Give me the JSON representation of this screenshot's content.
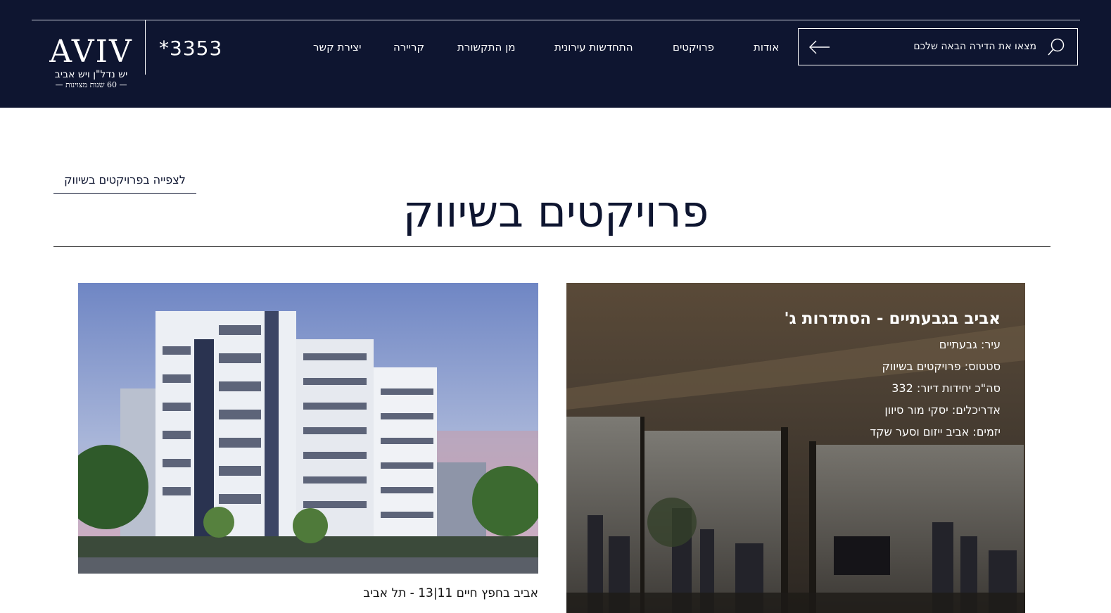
{
  "header": {
    "logo_word": "AVIV",
    "logo_sub": "יש נדל\"ן ויש אביב",
    "logo_tag": "— 60 שנות מצוינות —",
    "phone": "*3353",
    "nav": [
      "אודות",
      "פרויקטים",
      "התחדשות עירונית",
      "מן התקשורת",
      "קריירה",
      "יצירת קשר"
    ],
    "search_placeholder": "מצאו את הדירה הבאה שלכם"
  },
  "main": {
    "title": "פרויקטים בשיווק",
    "view_link": "לצפייה בפרויקטים בשיווק"
  },
  "cards": {
    "left": {
      "caption": "אביב בחפץ חיים 11|13 - תל אביב"
    },
    "right": {
      "title": "אביב בגבעתיים - הסתדרות ג'",
      "rows": [
        "עיר: גבעתיים",
        "סטטוס: פרויקטים בשיווק",
        "סה\"כ יחידות דיור: 332",
        "אדריכלים: יסקי מור סיוון",
        "יזמים: אביב ייזום וסער שקד"
      ]
    }
  },
  "colors": {
    "header_bg": "#0e1530",
    "text_dark": "#0e1530",
    "white": "#ffffff"
  },
  "icons": [
    "search-icon",
    "arrow-left-icon"
  ]
}
